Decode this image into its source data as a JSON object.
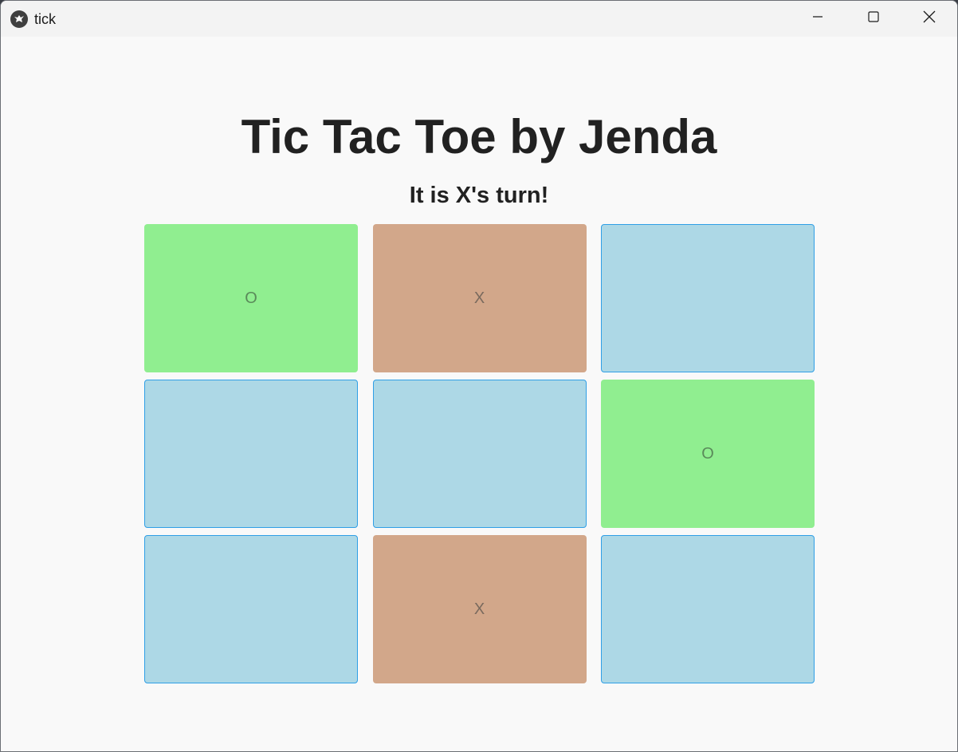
{
  "window": {
    "title": "tick",
    "controls": {
      "minimize_icon": "minimize-icon",
      "maximize_icon": "maximize-icon",
      "close_icon": "close-icon"
    }
  },
  "game": {
    "heading": "Tic Tac Toe by Jenda",
    "status": "It is X's turn!",
    "cells": [
      {
        "mark": "O",
        "state": "o"
      },
      {
        "mark": "X",
        "state": "x"
      },
      {
        "mark": "",
        "state": "empty"
      },
      {
        "mark": "",
        "state": "empty"
      },
      {
        "mark": "",
        "state": "empty"
      },
      {
        "mark": "O",
        "state": "o"
      },
      {
        "mark": "",
        "state": "empty"
      },
      {
        "mark": "X",
        "state": "x"
      },
      {
        "mark": "",
        "state": "empty"
      }
    ]
  },
  "colors": {
    "empty_cell": "#add8e6",
    "o_cell": "#90ee90",
    "x_cell": "#d2a78a",
    "empty_border": "#2f9fe6"
  }
}
